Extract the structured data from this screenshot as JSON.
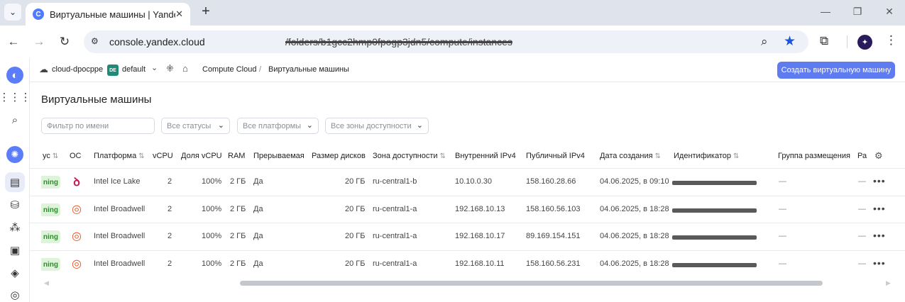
{
  "browser": {
    "tab_title": "Виртуальные машины | Yandex",
    "url_host": "console.yandex.cloud",
    "url_path": "/folders/b1gcc2hmp0fpogp3jdn5/compute/instances"
  },
  "header": {
    "cloud": "cloud-dpocppe",
    "folder_badge": "DE",
    "folder": "default",
    "service": "Compute Cloud",
    "separator": "/",
    "section": "Виртуальные машины",
    "create_button": "Создать виртуальную машину"
  },
  "page": {
    "title": "Виртуальные машины",
    "filters": {
      "name_placeholder": "Фильтр по имени",
      "statuses": "Все статусы",
      "platforms": "Все платформы",
      "zones": "Все зоны доступности"
    }
  },
  "table": {
    "columns": {
      "status": "ус",
      "os": "ОС",
      "platform": "Платформа",
      "vcpu": "vCPU",
      "vcpu_share": "Доля vCPU",
      "ram": "RAM",
      "preemptible": "Прерываемая",
      "disk_size": "Размер дисков",
      "zone": "Зона доступности",
      "internal_ip": "Внутренний IPv4",
      "public_ip": "Публичный IPv4",
      "created": "Дата создания",
      "id": "Идентификатор",
      "placement": "Группа размещения",
      "extra": "Ра"
    },
    "rows": [
      {
        "status": "ning",
        "os": "debian",
        "platform": "Intel Ice Lake",
        "vcpu": "2",
        "share": "100%",
        "ram": "2 ГБ",
        "preemptible": "Да",
        "disk": "20 ГБ",
        "zone": "ru-central1-b",
        "internal_ip": "10.10.0.30",
        "public_ip": "158.160.28.66",
        "created": "04.06.2025, в 09:10",
        "placement": "—",
        "extra": "—"
      },
      {
        "status": "ning",
        "os": "ubuntu",
        "platform": "Intel Broadwell",
        "vcpu": "2",
        "share": "100%",
        "ram": "2 ГБ",
        "preemptible": "Да",
        "disk": "20 ГБ",
        "zone": "ru-central1-a",
        "internal_ip": "192.168.10.13",
        "public_ip": "158.160.56.103",
        "created": "04.06.2025, в 18:28",
        "placement": "—",
        "extra": "—"
      },
      {
        "status": "ning",
        "os": "ubuntu",
        "platform": "Intel Broadwell",
        "vcpu": "2",
        "share": "100%",
        "ram": "2 ГБ",
        "preemptible": "Да",
        "disk": "20 ГБ",
        "zone": "ru-central1-a",
        "internal_ip": "192.168.10.17",
        "public_ip": "89.169.154.151",
        "created": "04.06.2025, в 18:28",
        "placement": "—",
        "extra": "—"
      },
      {
        "status": "ning",
        "os": "ubuntu",
        "platform": "Intel Broadwell",
        "vcpu": "2",
        "share": "100%",
        "ram": "2 ГБ",
        "preemptible": "Да",
        "disk": "20 ГБ",
        "zone": "ru-central1-a",
        "internal_ip": "192.168.10.11",
        "public_ip": "158.160.56.231",
        "created": "04.06.2025, в 18:28",
        "placement": "—",
        "extra": "—"
      }
    ]
  }
}
